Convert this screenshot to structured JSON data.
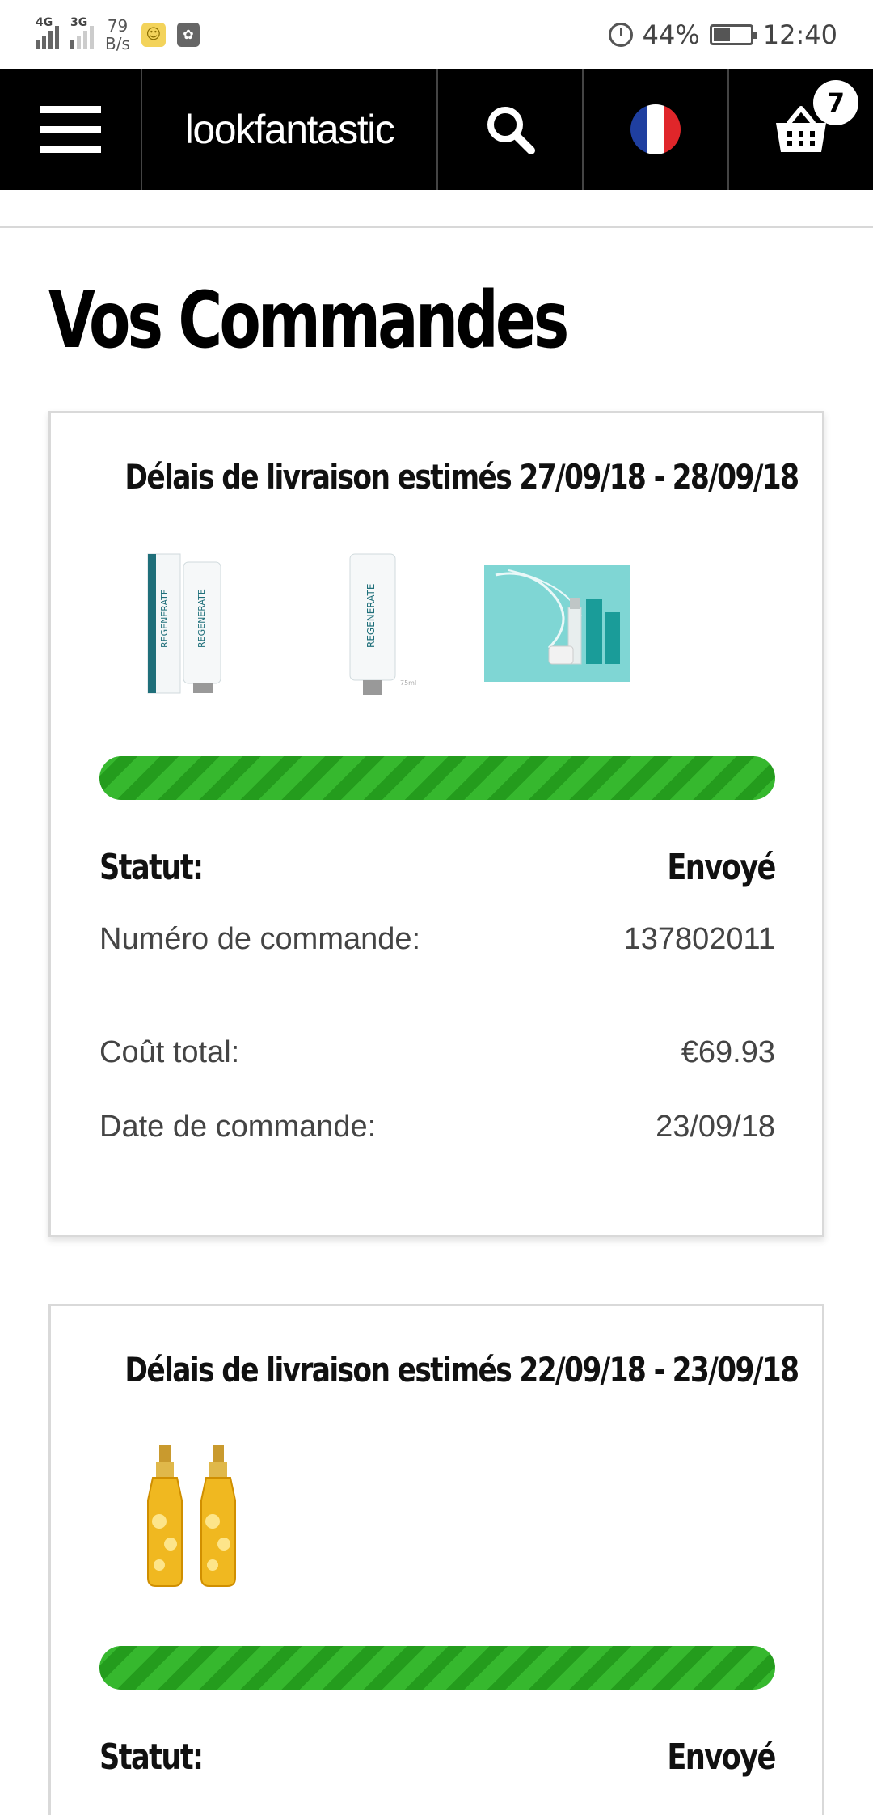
{
  "status_bar": {
    "network1": "4G",
    "network2": "3G",
    "speed_value": "79",
    "speed_unit": "B/s",
    "battery": "44%",
    "time": "12:40"
  },
  "header": {
    "logo": "lookfantastic",
    "cart_count": "7",
    "flag": [
      "#1f3fa0",
      "#ffffff",
      "#e0262a"
    ]
  },
  "page": {
    "title": "Vos Commandes"
  },
  "orders": [
    {
      "delivery": "Délais de livraison estimés 27/09/18 - 28/09/18",
      "products": [
        "regenerate-toothpaste-twin-icon",
        "regenerate-toothpaste-icon",
        "beauty-gift-set-icon"
      ],
      "progress": 1.0,
      "status_label": "Statut:",
      "status_value": "Envoyé",
      "order_number_label": "Numéro de commande:",
      "order_number": "137802011",
      "total_label": "Coût total:",
      "total": "€69.93",
      "date_label": "Date de commande:",
      "date": "23/09/18"
    },
    {
      "delivery": "Délais de livraison estimés 22/09/18 - 23/09/18",
      "products": [
        "kerastase-elixir-oil-icon"
      ],
      "progress": 1.0,
      "status_label": "Statut:",
      "status_value": "Envoyé"
    }
  ],
  "colors": {
    "header_bg": "#000000",
    "progress_green": "#36b82e",
    "progress_stripe": "#249c1d"
  }
}
